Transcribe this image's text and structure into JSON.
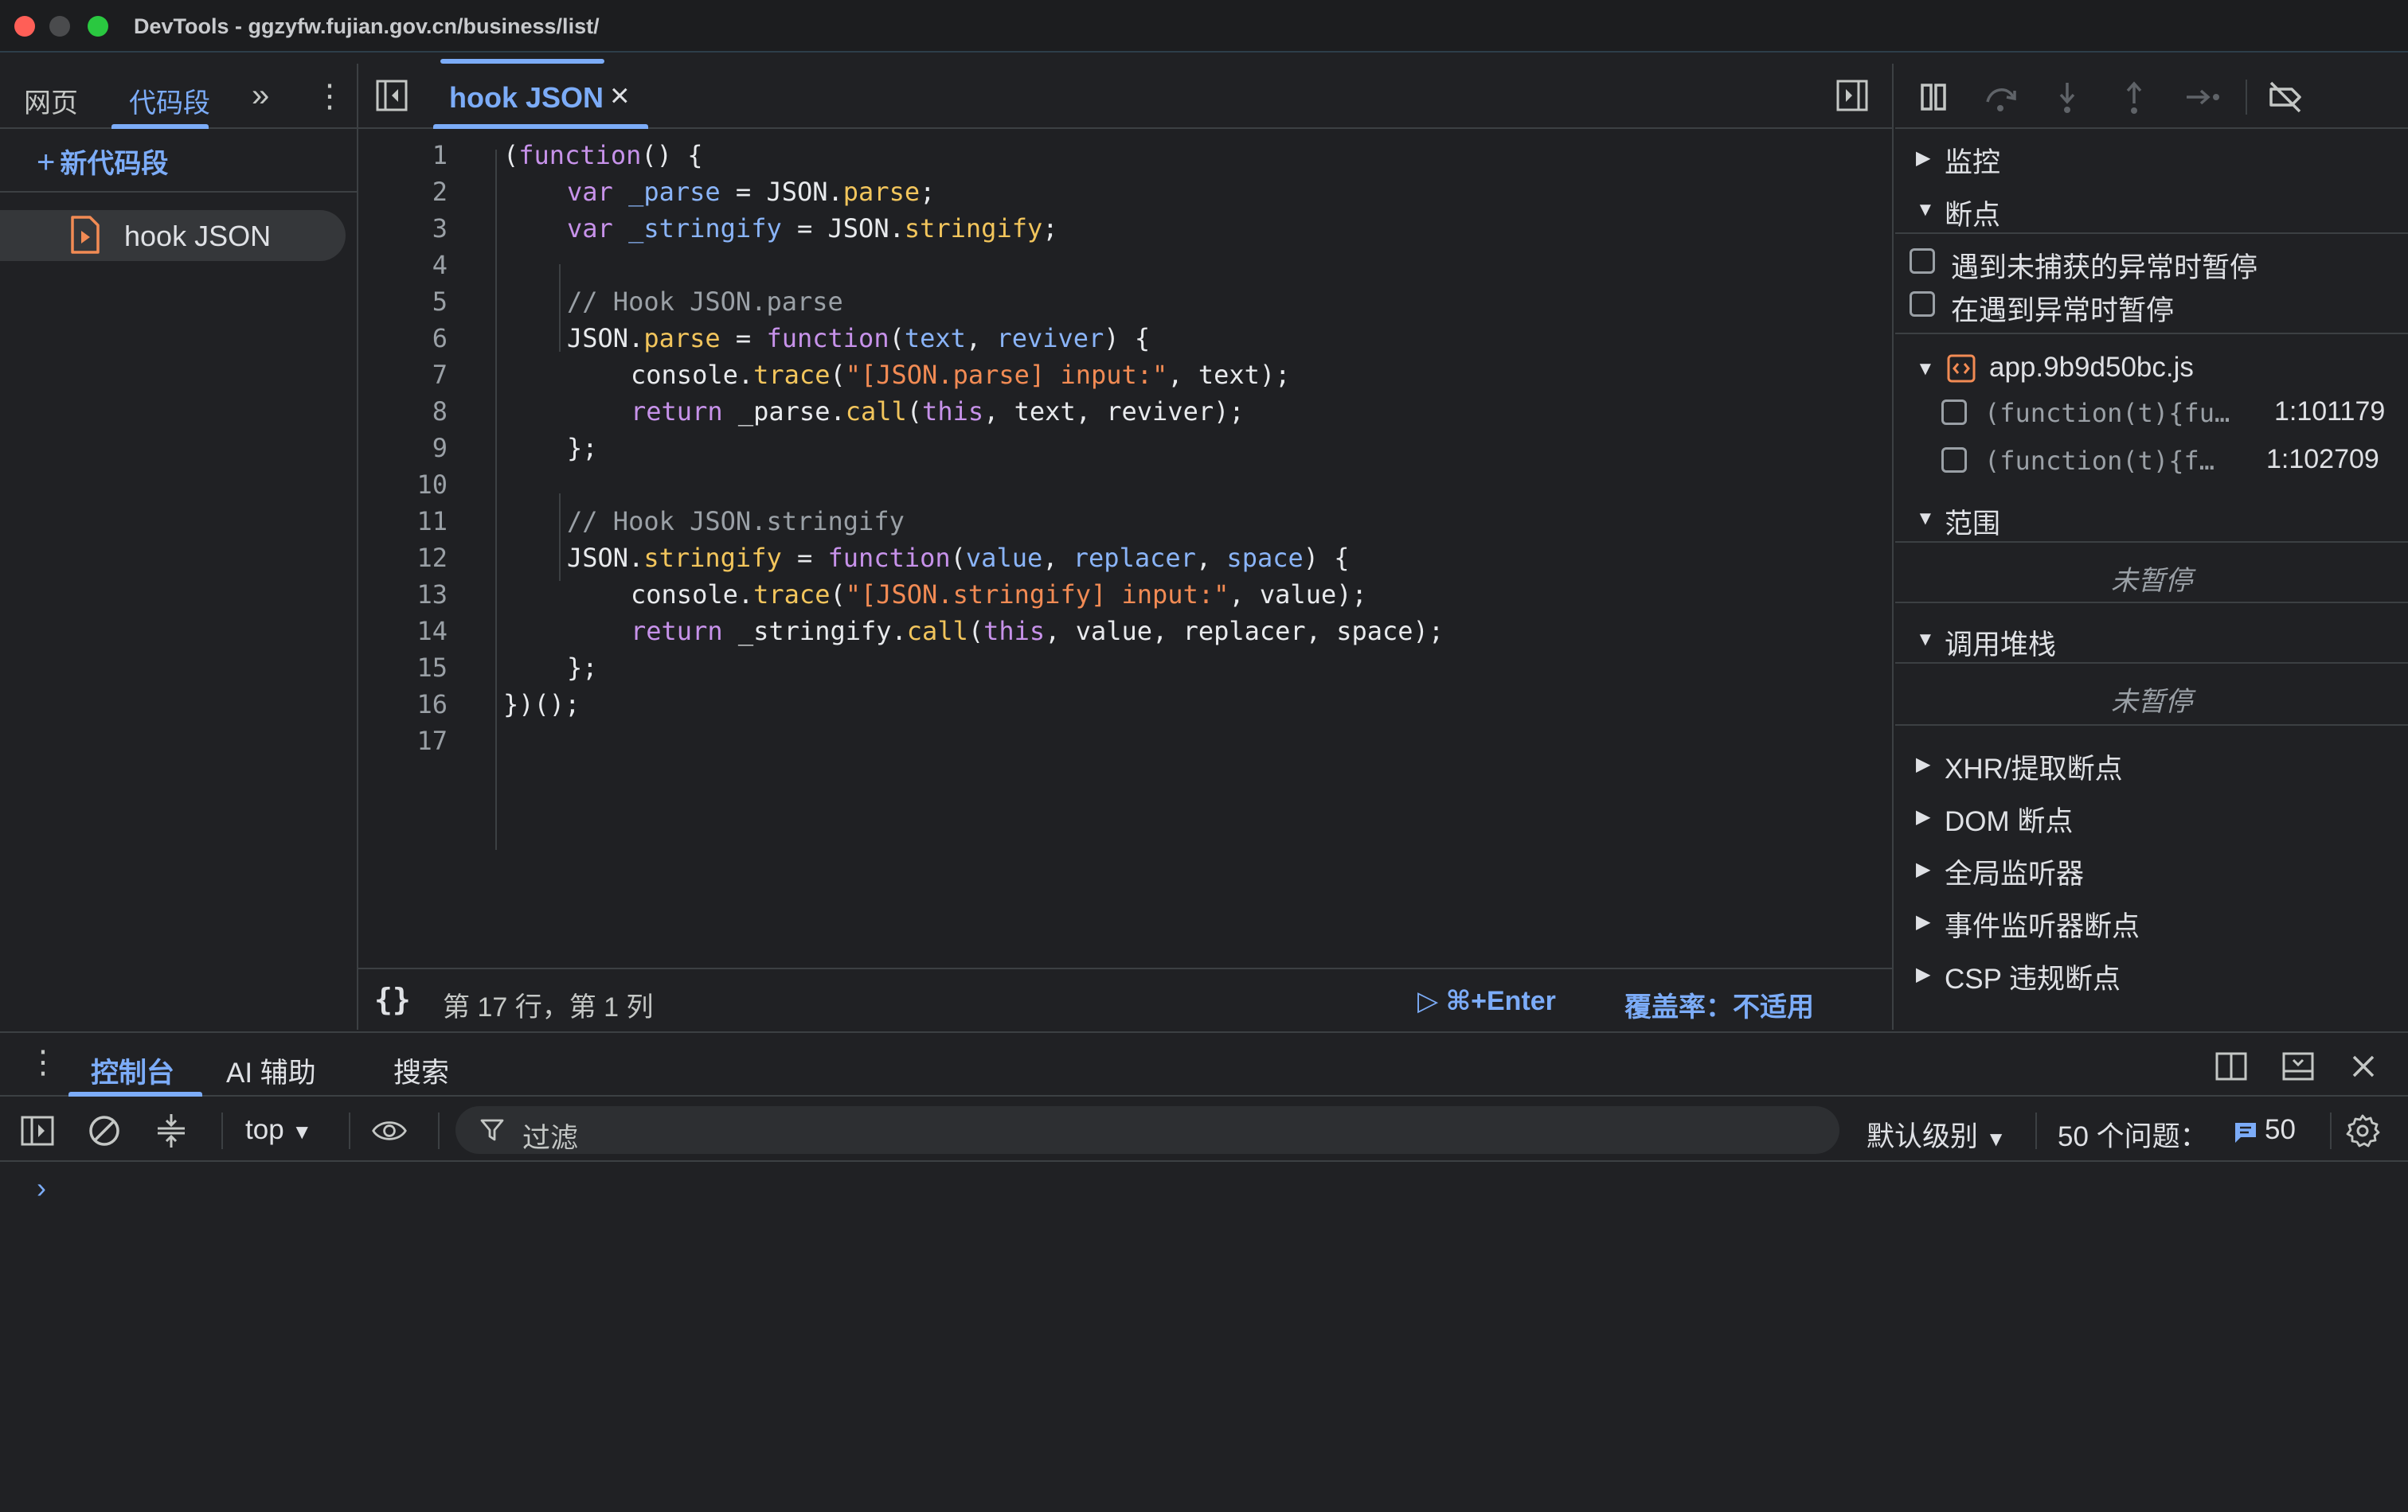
{
  "window": {
    "title": "DevTools - ggzyfw.fujian.gov.cn/business/list/"
  },
  "left_panel": {
    "tabs": [
      {
        "label": "网页"
      },
      {
        "label": "代码段"
      }
    ],
    "new_snippet_label": "新代码段",
    "snippets": [
      {
        "label": "hook JSON"
      }
    ]
  },
  "editor": {
    "tab_label": "hook JSON",
    "status": {
      "position": "第 17 行，第 1 列",
      "run": "⌘+Enter",
      "coverage": "覆盖率：不适用"
    },
    "lines": [
      {
        "n": "1"
      },
      {
        "n": "2"
      },
      {
        "n": "3"
      },
      {
        "n": "4"
      },
      {
        "n": "5"
      },
      {
        "n": "6"
      },
      {
        "n": "7"
      },
      {
        "n": "8"
      },
      {
        "n": "9"
      },
      {
        "n": "10"
      },
      {
        "n": "11"
      },
      {
        "n": "12"
      },
      {
        "n": "13"
      },
      {
        "n": "14"
      },
      {
        "n": "15"
      },
      {
        "n": "16"
      },
      {
        "n": "17"
      }
    ],
    "code": {
      "l1a": "(",
      "l1b": "function",
      "l1c": "() {",
      "l2a": "var",
      "l2b": " _parse",
      "l2c": " = JSON.",
      "l2d": "parse",
      "l2e": ";",
      "l3a": "var",
      "l3b": " _stringify",
      "l3c": " = JSON.",
      "l3d": "stringify",
      "l3e": ";",
      "l5": "// Hook JSON.parse",
      "l6a": "JSON.",
      "l6b": "parse",
      "l6c": " = ",
      "l6d": "function",
      "l6e": "(",
      "l6f": "text",
      "l6g": ", ",
      "l6h": "reviver",
      "l6i": ") {",
      "l7a": "console.",
      "l7b": "trace",
      "l7c": "(",
      "l7d": "\"[JSON.parse] input:\"",
      "l7e": ", text);",
      "l8a": "return",
      "l8b": " _parse.",
      "l8c": "call",
      "l8d": "(",
      "l8e": "this",
      "l8f": ", text, reviver);",
      "l9": "};",
      "l11": "// Hook JSON.stringify",
      "l12a": "JSON.",
      "l12b": "stringify",
      "l12c": " = ",
      "l12d": "function",
      "l12e": "(",
      "l12f": "value",
      "l12g": ", ",
      "l12h": "replacer",
      "l12i": ", ",
      "l12j": "space",
      "l12k": ") {",
      "l13a": "console.",
      "l13b": "trace",
      "l13c": "(",
      "l13d": "\"[JSON.stringify] input:\"",
      "l13e": ", value);",
      "l14a": "return",
      "l14b": " _stringify.",
      "l14c": "call",
      "l14d": "(",
      "l14e": "this",
      "l14f": ", value, replacer, space);",
      "l15": "};",
      "l16": "})();"
    }
  },
  "debugger": {
    "watch": "监控",
    "breakpoints": "断点",
    "pause_uncaught": "遇到未捕获的异常时暂停",
    "pause_caught": "在遇到异常时暂停",
    "file": "app.9b9d50bc.js",
    "bp_items": [
      {
        "code": "(function(t){fu…",
        "loc": "1:101179"
      },
      {
        "code": "(function(t){f…",
        "loc": "1:102709"
      }
    ],
    "scope": "范围",
    "scope_status": "未暂停",
    "callstack": "调用堆栈",
    "callstack_status": "未暂停",
    "xhr": "XHR/提取断点",
    "dom": "DOM 断点",
    "global": "全局监听器",
    "event": "事件监听器断点",
    "csp": "CSP 违规断点"
  },
  "drawer": {
    "tabs": [
      {
        "label": "控制台"
      },
      {
        "label": "AI 辅助"
      },
      {
        "label": "搜索"
      }
    ],
    "context": "top",
    "filter_placeholder": "过滤",
    "level": "默认级别",
    "issues_label": "50 个问题：",
    "issues_count": "50"
  }
}
